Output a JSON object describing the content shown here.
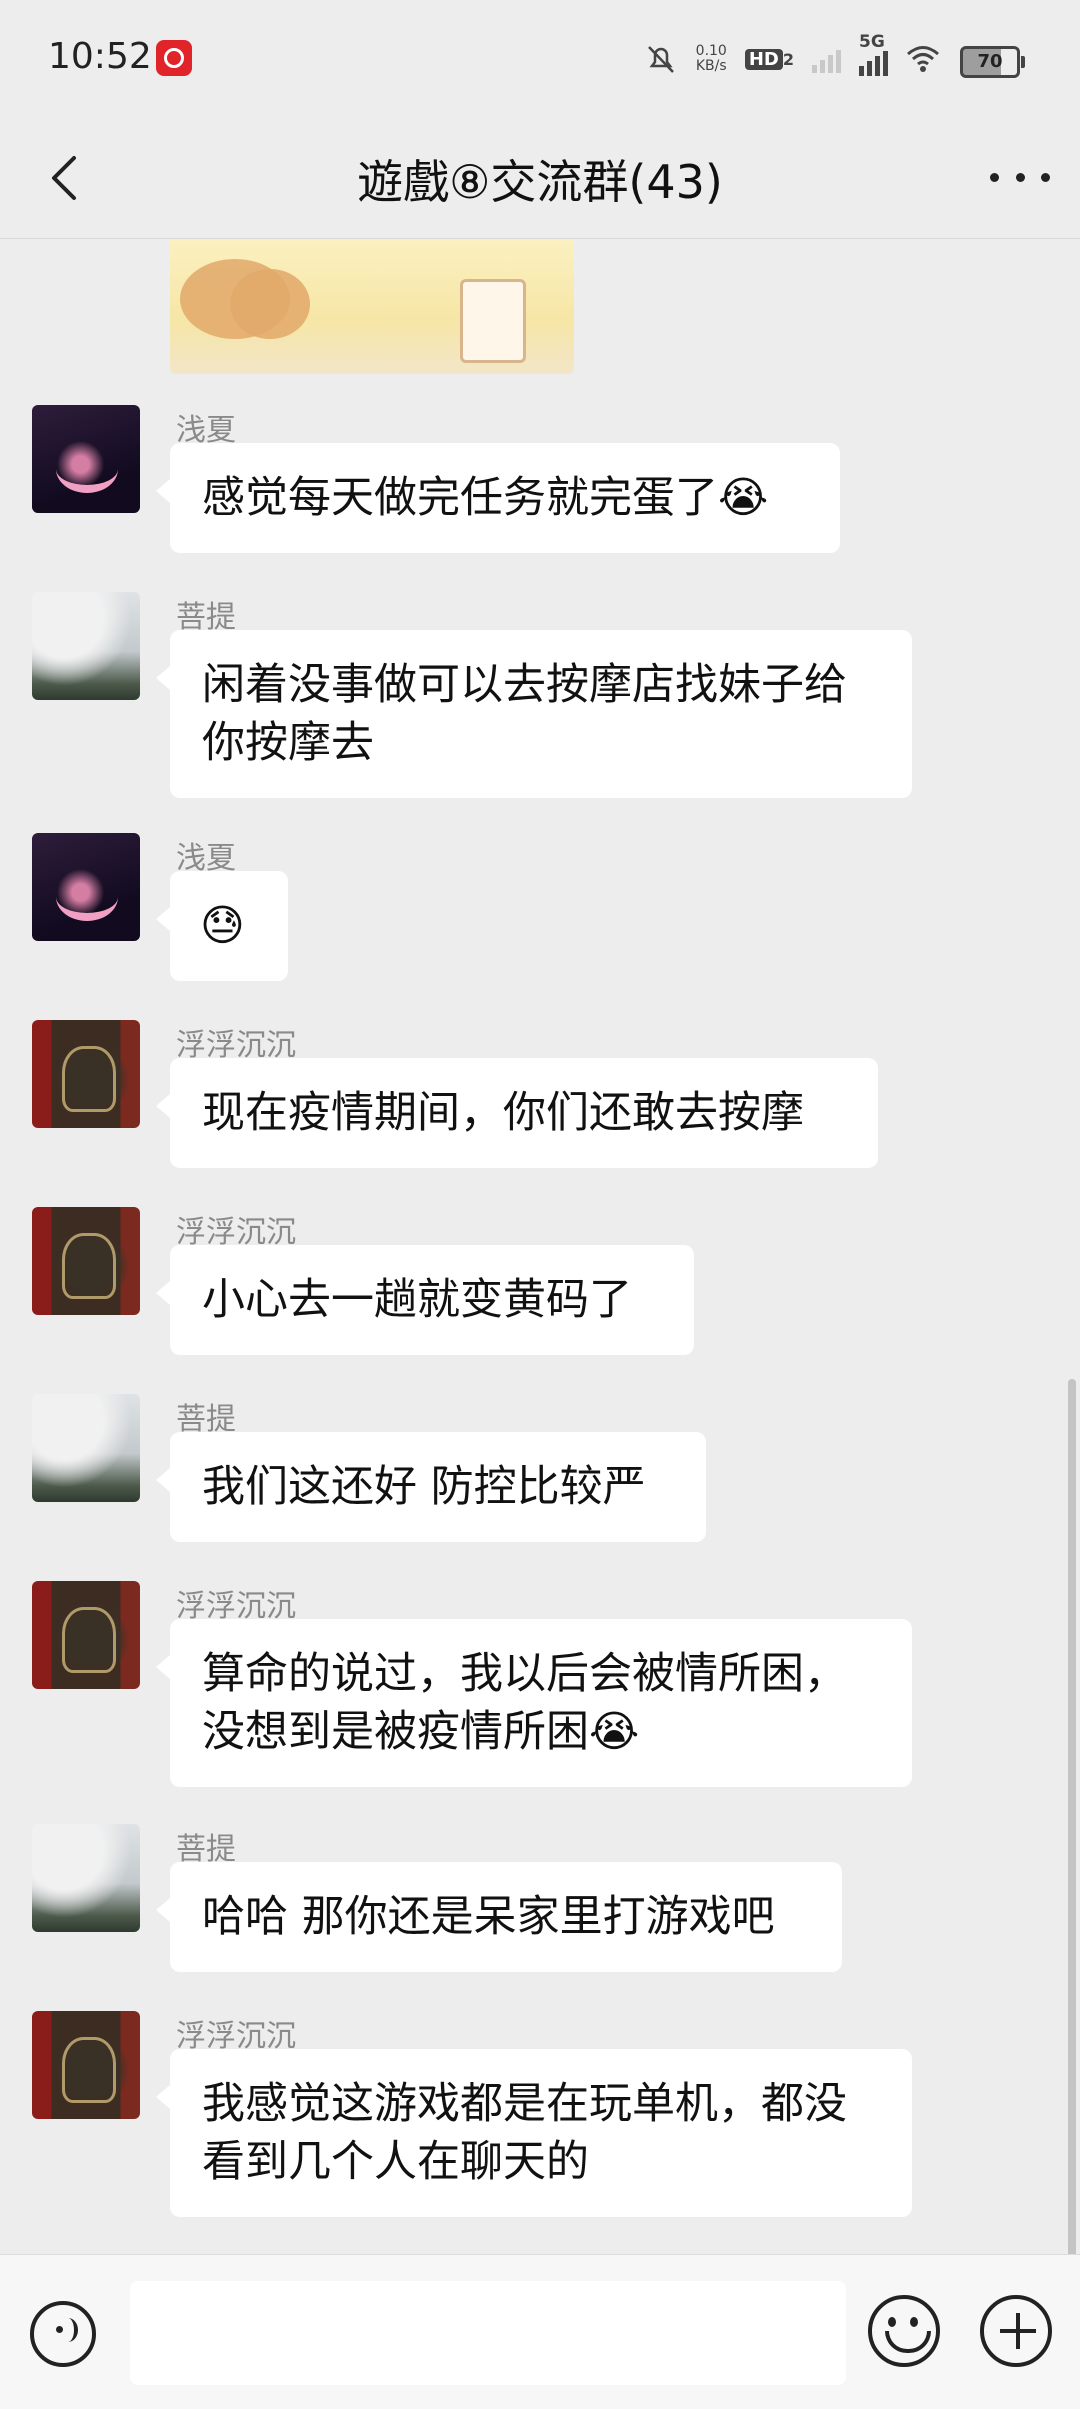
{
  "status_bar": {
    "time": "10:52",
    "speed_value": "0.10",
    "speed_unit": "KB/s",
    "hd_label": "HD",
    "hd_sub": "2",
    "network": "5G",
    "battery": "70"
  },
  "header": {
    "title": "遊戲⑧交流群(43)"
  },
  "messages": [
    {
      "sender": "浅夏",
      "text": "感觉每天做完任务就完蛋了😭"
    },
    {
      "sender": "菩提",
      "text": "闲着没事做可以去按摩店找妹子给你按摩去"
    },
    {
      "sender": "浅夏",
      "text": "😓"
    },
    {
      "sender": "浮浮沉沉",
      "text": "现在疫情期间，你们还敢去按摩"
    },
    {
      "sender": "浮浮沉沉",
      "text": "小心去一趟就变黄码了"
    },
    {
      "sender": "菩提",
      "text": "我们这还好 防控比较严"
    },
    {
      "sender": "浮浮沉沉",
      "text": "算命的说过，我以后会被情所困，没想到是被疫情所困😭"
    },
    {
      "sender": "菩提",
      "text": "哈哈 那你还是呆家里打游戏吧"
    },
    {
      "sender": "浮浮沉沉",
      "text": "我感觉这游戏都是在玩单机，都没看到几个人在聊天的"
    }
  ],
  "input": {
    "value": "",
    "icons": [
      "voice-icon",
      "emoji-icon",
      "plus-icon"
    ]
  },
  "colors": {
    "background": "#ededed",
    "bubble": "#ffffff",
    "sender_name": "#8a8a8a"
  }
}
